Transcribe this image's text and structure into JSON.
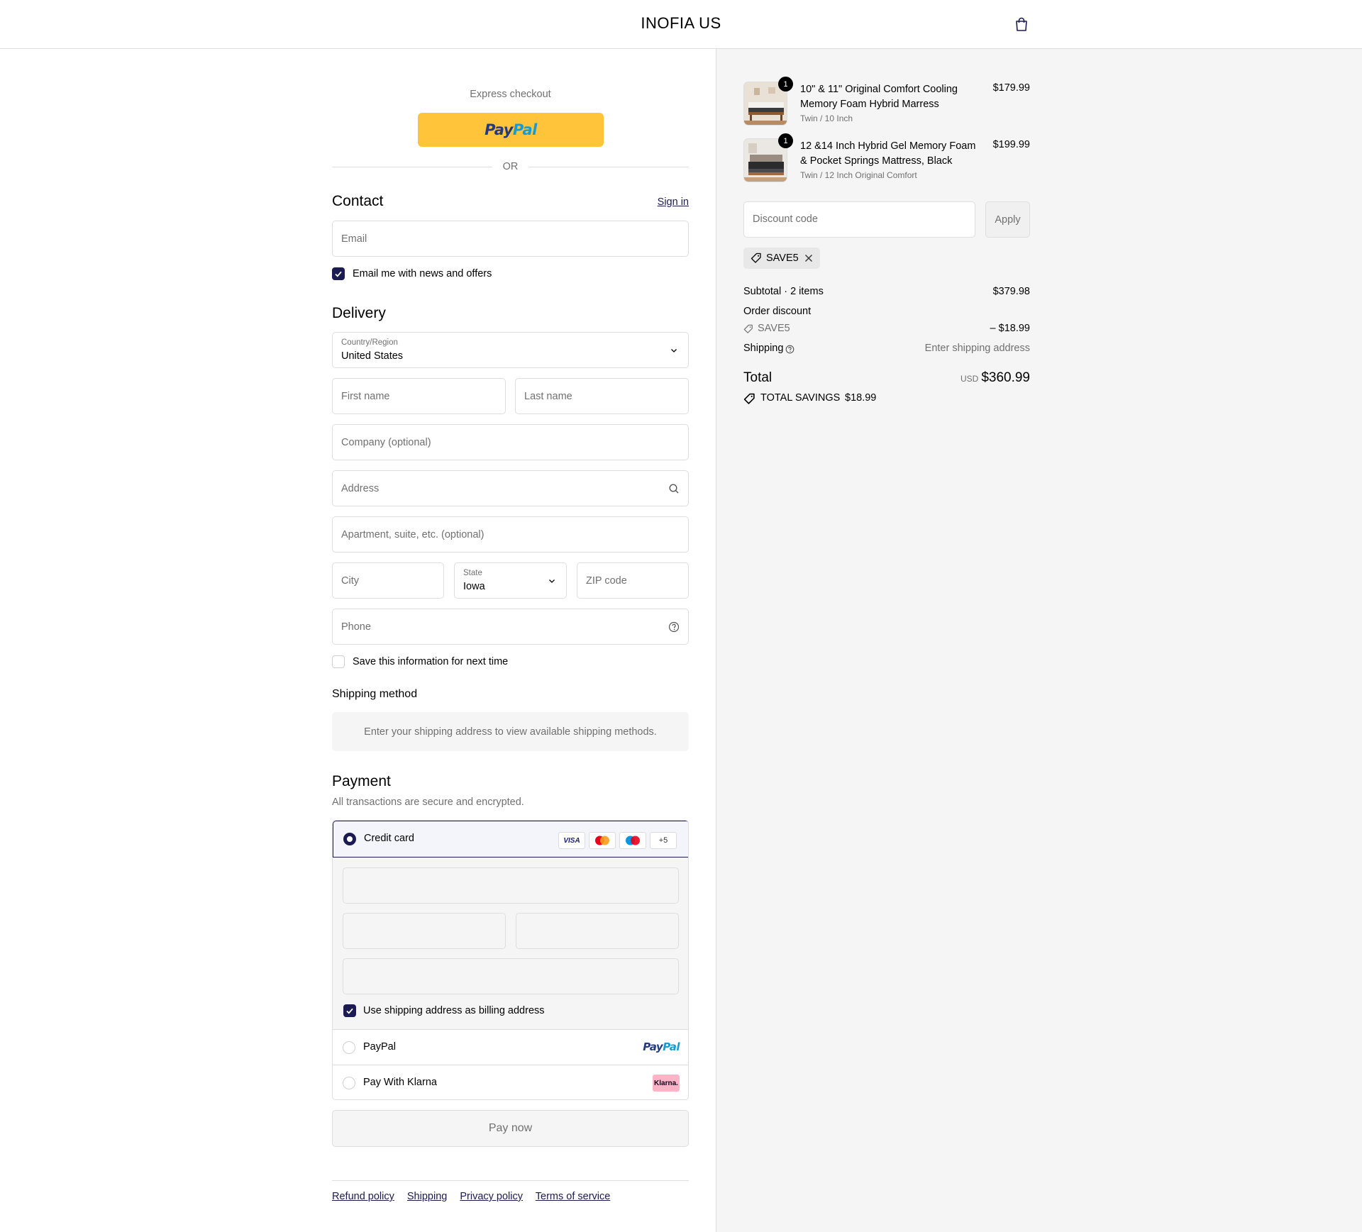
{
  "header": {
    "brand": "INOFIA US",
    "cart_icon": "shopping-bag-icon"
  },
  "express": {
    "label": "Express checkout",
    "paypal_pay": "Pay",
    "paypal_pal": "Pal",
    "or": "OR"
  },
  "contact": {
    "title": "Contact",
    "sign_in": "Sign in",
    "email_placeholder": "Email",
    "news_label": "Email me with news and offers",
    "news_checked": true
  },
  "delivery": {
    "title": "Delivery",
    "country_label": "Country/Region",
    "country_value": "United States",
    "first_name": "First name",
    "last_name": "Last name",
    "company": "Company (optional)",
    "address": "Address",
    "apartment": "Apartment, suite, etc. (optional)",
    "city": "City",
    "state_label": "State",
    "state_value": "Iowa",
    "zip": "ZIP code",
    "phone": "Phone",
    "save_info": "Save this information for next time"
  },
  "shipping_method": {
    "title": "Shipping method",
    "info": "Enter your shipping address to view available shipping methods."
  },
  "payment": {
    "title": "Payment",
    "subtitle": "All transactions are secure and encrypted.",
    "credit_card": "Credit card",
    "badges": [
      "VISA",
      "",
      "",
      "+5"
    ],
    "billing_same": "Use shipping address as billing address",
    "paypal": "PayPal",
    "paypal_logo_a": "Pay",
    "paypal_logo_b": "Pal",
    "klarna": "Pay With Klarna",
    "klarna_logo": "Klarna.",
    "pay_now": "Pay now"
  },
  "footer": {
    "links": [
      "Refund policy",
      "Shipping",
      "Privacy policy",
      "Terms of service"
    ]
  },
  "summary": {
    "items": [
      {
        "qty": "1",
        "name": "10\" & 11\" Original Comfort Cooling Memory Foam Hybrid Marress",
        "variant": "Twin / 10 Inch",
        "price": "$179.99"
      },
      {
        "qty": "1",
        "name": "12 &14 Inch Hybrid Gel Memory Foam & Pocket Springs Mattress, Black",
        "variant": "Twin / 12 Inch Original Comfort",
        "price": "$199.99"
      }
    ],
    "discount_placeholder": "Discount code",
    "apply": "Apply",
    "applied_code": "SAVE5",
    "subtotal_label": "Subtotal · 2 items",
    "subtotal_value": "$379.98",
    "order_discount_label": "Order discount",
    "discount_code": "SAVE5",
    "discount_value": "– $18.99",
    "shipping_label": "Shipping",
    "shipping_value": "Enter shipping address",
    "total_label": "Total",
    "currency": "USD",
    "total_value": "$360.99",
    "savings_label": "TOTAL SAVINGS",
    "savings_value": "$18.99"
  },
  "colors": {
    "accent": "#1b1b52",
    "paypal_yellow": "#ffc439",
    "klarna_pink": "#ffb3c7",
    "summary_bg": "#f5f5f5"
  }
}
